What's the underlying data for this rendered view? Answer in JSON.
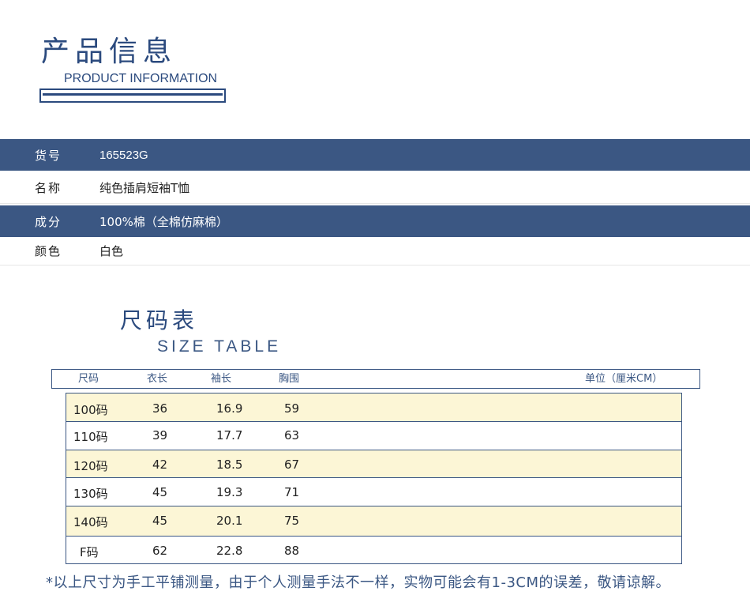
{
  "header": {
    "title_cn": "产品信息",
    "title_en": "PRODUCT INFORMATION"
  },
  "info": [
    {
      "label": "货号",
      "value": "165523G"
    },
    {
      "label": "名称",
      "value": "纯色插肩短袖T恤"
    },
    {
      "label": "成分",
      "value": "100%棉（全棉仿麻棉）"
    },
    {
      "label": "颜色",
      "value": "白色"
    }
  ],
  "size_table": {
    "title_cn": "尺码表",
    "title_en": "SIZE TABLE",
    "columns": [
      "尺码",
      "衣长",
      "袖长",
      "胸围"
    ],
    "unit": "单位（厘米CM）",
    "rows": [
      [
        "100码",
        "36",
        "16.9",
        "59"
      ],
      [
        "110码",
        "39",
        "17.7",
        "63"
      ],
      [
        "120码",
        "42",
        "18.5",
        "67"
      ],
      [
        "130码",
        "45",
        "19.3",
        "71"
      ],
      [
        "140码",
        "45",
        "20.1",
        "75"
      ],
      [
        "F码",
        "62",
        "22.8",
        "88"
      ]
    ],
    "footnote": "*以上尺寸为手工平铺测量，由于个人测量手法不一样，实物可能会有1-3CM的误差，敬请谅解。"
  },
  "colors": {
    "brand_blue": "#3b5783",
    "title_blue": "#2b4a7e",
    "row_highlight": "#fcf6d6"
  }
}
